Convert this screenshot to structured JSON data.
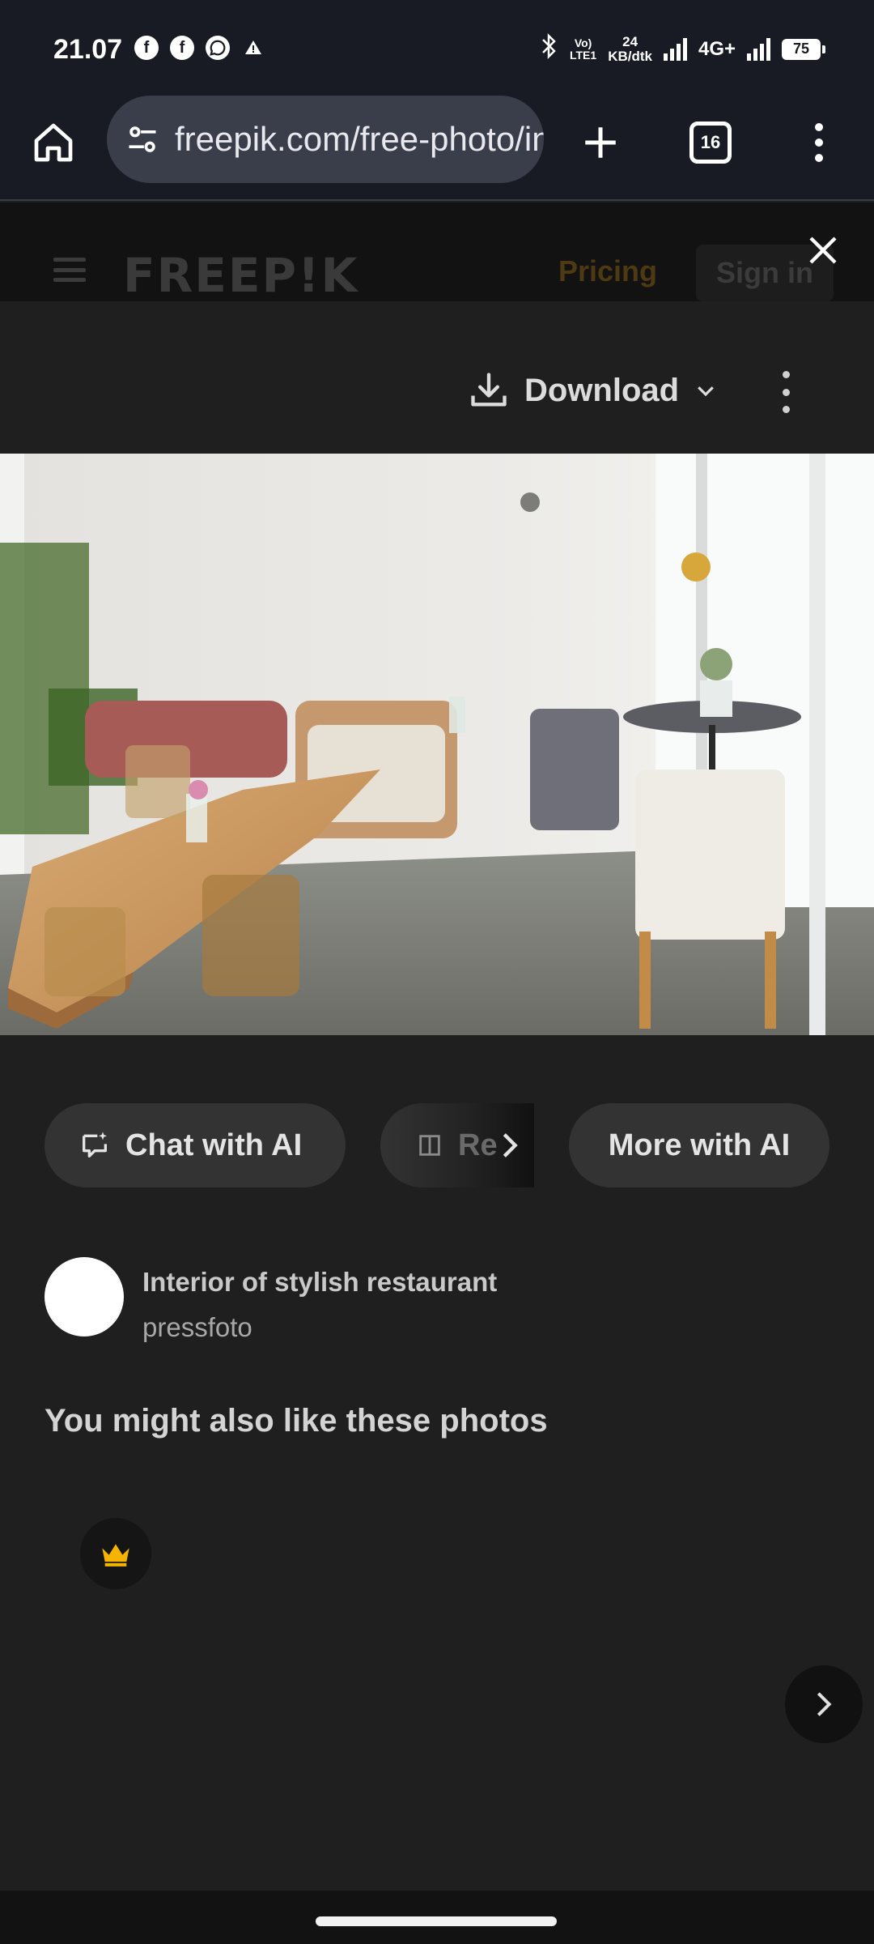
{
  "status_bar": {
    "time": "21.07",
    "volte_line1": "Vo)",
    "volte_line2": "LTE1",
    "net_speed_value": "24",
    "net_speed_unit": "KB/dtk",
    "network_type": "4G+",
    "battery": "75",
    "notification_icons": [
      "facebook-icon",
      "facebook-icon",
      "whatsapp-icon",
      "warning-icon"
    ]
  },
  "browser": {
    "url": "freepik.com/free-photo/interior-of-stylish-restaurant",
    "tab_count": "16"
  },
  "site_header": {
    "logo": "FREEP!K",
    "pricing": "Pricing",
    "sign_in": "Sign in"
  },
  "toolbar": {
    "download_label": "Download"
  },
  "ai_actions": {
    "chat": "Chat with AI",
    "middle": "Re",
    "more": "More with AI"
  },
  "resource": {
    "title": "Interior of stylish restaurant",
    "author": "pressfoto"
  },
  "related": {
    "heading": "You might also like these photos"
  },
  "colors": {
    "background": "#1f1f1f",
    "browser_bar": "#181b24",
    "crown": "#f5b400"
  }
}
